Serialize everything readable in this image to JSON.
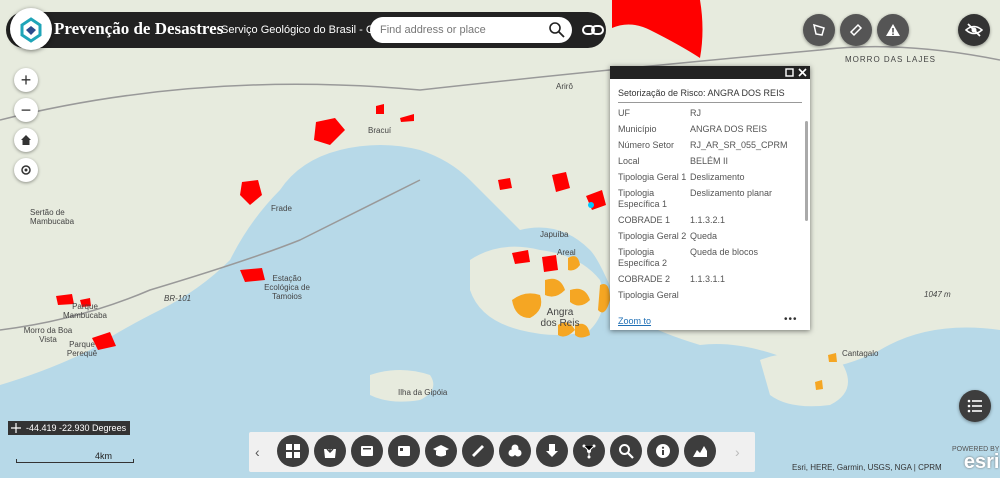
{
  "header": {
    "app_title": "Prevenção de Desastres",
    "subtitle": "Serviço Geológico do Brasil - CPRM",
    "search_placeholder": "Find address or place"
  },
  "top_right_buttons": [
    "measure-icon",
    "broom-icon",
    "warning-icon",
    "visibility-off-icon"
  ],
  "map_labels": [
    "MORRO DAS LAJES",
    "Arirô",
    "Bracuí",
    "Sertão de Mambucaba",
    "Frade",
    "Estação Ecológica de Tamoios",
    "Parque Mambucaba",
    "Morro da Boa Vista",
    "Parque Perequê",
    "Japuíba",
    "Areal",
    "Angra dos Reis",
    "Ilha da Gipóia",
    "Cantagalo",
    "1047 m",
    "BR-101"
  ],
  "popup": {
    "title": "Setorização de Risco: ANGRA DOS REIS",
    "rows": [
      {
        "key": "UF",
        "value": "RJ"
      },
      {
        "key": "Município",
        "value": "ANGRA DOS REIS"
      },
      {
        "key": "Número Setor",
        "value": "RJ_AR_SR_055_CPRM"
      },
      {
        "key": "Local",
        "value": "BELÉM II"
      },
      {
        "key": "Tipologia Geral 1",
        "value": "Deslizamento"
      },
      {
        "key": "Tipologia Específica 1",
        "value": "Deslizamento planar"
      },
      {
        "key": "COBRADE 1",
        "value": "1.1.3.2.1"
      },
      {
        "key": "Tipologia Geral 2",
        "value": "Queda"
      },
      {
        "key": "Tipologia Específica 2",
        "value": "Queda de blocos"
      },
      {
        "key": "COBRADE 2",
        "value": "1.1.3.1.1"
      },
      {
        "key": "Tipologia Geral",
        "value": ""
      }
    ],
    "zoom_to": "Zoom to",
    "more": "•••"
  },
  "coordinates": "-44.419 -22.930 Degrees",
  "scale": "4km",
  "toolbar_icons": [
    "basemap-gallery-icon",
    "add-data-icon",
    "layer-list-icon",
    "legend-icon",
    "education-icon",
    "measurement-icon",
    "analysis-icon",
    "download-icon",
    "share-icon",
    "search-icon",
    "info-icon",
    "elevation-profile-icon"
  ],
  "attribution": "Esri, HERE, Garmin, USGS, NGA | CPRM",
  "esri_logo": {
    "top": "POWERED BY",
    "main": "esri"
  },
  "colors": {
    "risk_high": "#ff0000",
    "risk_medium": "#f5a623",
    "water": "#b7d9e8",
    "land": "#e8ecdf"
  }
}
